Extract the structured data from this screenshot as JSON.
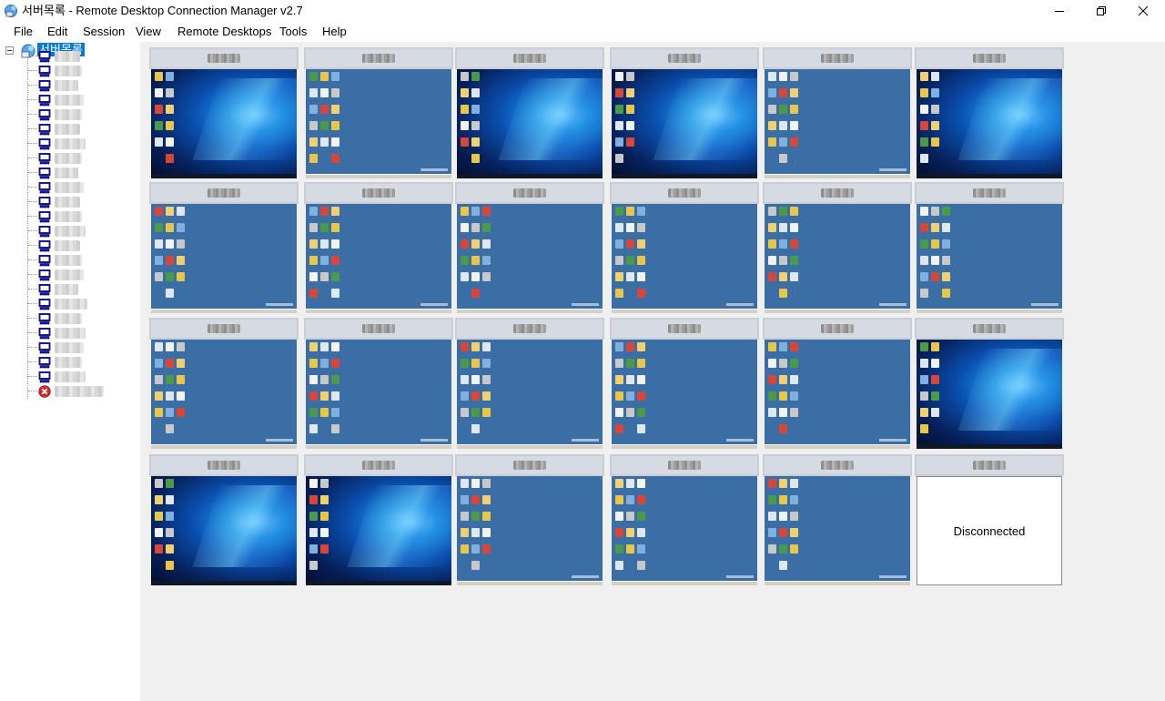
{
  "window": {
    "title": "서버목록 - Remote Desktop Connection Manager v2.7",
    "minimize": "—",
    "maximize": "❐",
    "close": "✕"
  },
  "menu": [
    "File",
    "Edit",
    "Session",
    "View",
    "Remote Desktops",
    "Tools",
    "Help"
  ],
  "tree": {
    "root_label": "서버목록",
    "node_count": 24,
    "disconnected_node_index": 23
  },
  "thumbnails": [
    {
      "screen": "win10"
    },
    {
      "screen": "classic"
    },
    {
      "screen": "win10"
    },
    {
      "screen": "win10"
    },
    {
      "screen": "classic"
    },
    {
      "screen": "win10"
    },
    {
      "screen": "classic"
    },
    {
      "screen": "classic"
    },
    {
      "screen": "classic"
    },
    {
      "screen": "classic"
    },
    {
      "screen": "classic"
    },
    {
      "screen": "classic"
    },
    {
      "screen": "classic"
    },
    {
      "screen": "classic"
    },
    {
      "screen": "classic"
    },
    {
      "screen": "classic"
    },
    {
      "screen": "classic"
    },
    {
      "screen": "win10"
    },
    {
      "screen": "win10"
    },
    {
      "screen": "win10"
    },
    {
      "screen": "classic"
    },
    {
      "screen": "classic"
    },
    {
      "screen": "classic"
    },
    {
      "screen": "disconnected",
      "status": "Disconnected"
    }
  ],
  "colors": {
    "selection": "#0a78d7",
    "classic_desktop": "#3a6ea5",
    "area_background": "#f0f0f0",
    "disconnected_icon": "#d7262d",
    "server_icon": "#1a1aa6"
  }
}
